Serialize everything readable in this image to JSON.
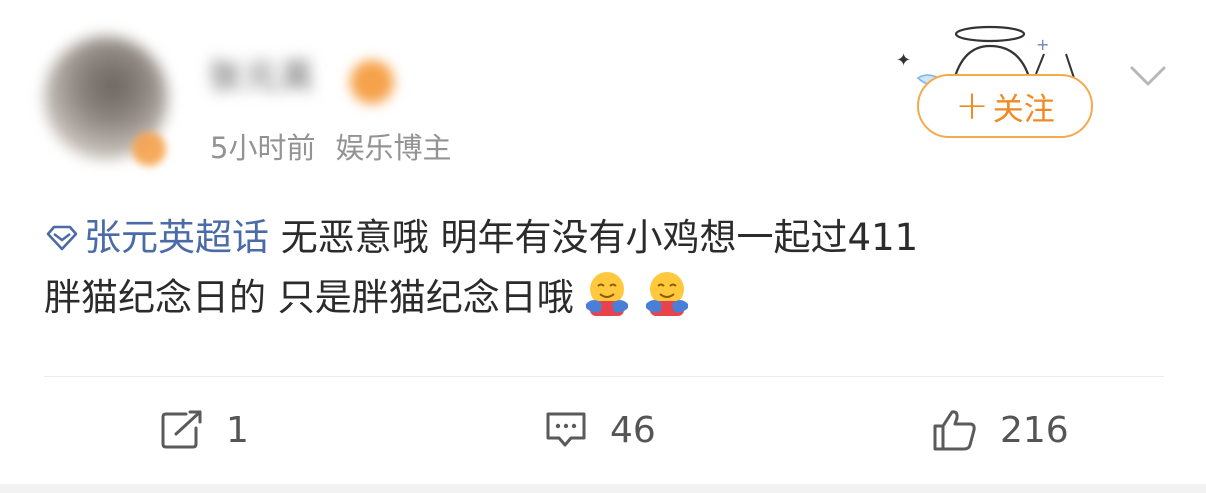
{
  "post": {
    "author": {
      "name": "张元英",
      "time_ago": "5小时前",
      "role": "娱乐博主",
      "badge_icon": "verified-badge-icon"
    },
    "follow_label": "关注",
    "follow_plus": "+",
    "topic": "张元英超话",
    "text_line1": "无恶意哦 明年有没有小鸡想一起过411",
    "text_line2": "胖猫纪念日的 只是胖猫纪念日哦",
    "emojis": [
      "hug-emoji",
      "hug-emoji"
    ]
  },
  "actions": {
    "repost_count": "1",
    "comment_count": "46",
    "like_count": "216"
  },
  "colors": {
    "accent_orange": "#f08a24",
    "topic_blue": "#4a6aa8",
    "text": "#2b2b2b",
    "meta": "#939393"
  }
}
